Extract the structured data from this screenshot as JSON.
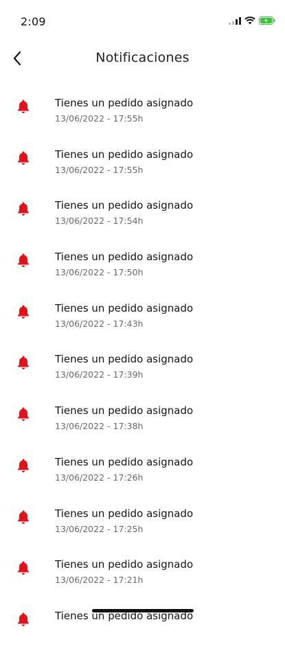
{
  "status_bar": {
    "time": "2:09"
  },
  "header": {
    "title": "Notificaciones"
  },
  "colors": {
    "bell": "#e0131a",
    "battery": "#3fc33f"
  },
  "icons": {
    "back": "chevron-left-icon",
    "notification": "bell-icon"
  },
  "notifications": [
    {
      "title": "Tienes un pedido asignado",
      "time": "13/06/2022 - 17:55h"
    },
    {
      "title": "Tienes un pedido asignado",
      "time": "13/06/2022 - 17:55h"
    },
    {
      "title": "Tienes un pedido asignado",
      "time": "13/06/2022 - 17:54h"
    },
    {
      "title": "Tienes un pedido asignado",
      "time": "13/06/2022 - 17:50h"
    },
    {
      "title": "Tienes un pedido asignado",
      "time": "13/06/2022 - 17:43h"
    },
    {
      "title": "Tienes un pedido asignado",
      "time": "13/06/2022 - 17:39h"
    },
    {
      "title": "Tienes un pedido asignado",
      "time": "13/06/2022 - 17:38h"
    },
    {
      "title": "Tienes un pedido asignado",
      "time": "13/06/2022 - 17:26h"
    },
    {
      "title": "Tienes un pedido asignado",
      "time": "13/06/2022 - 17:25h"
    },
    {
      "title": "Tienes un pedido asignado",
      "time": "13/06/2022 - 17:21h"
    },
    {
      "title": "Tienes un pedido asignado",
      "time": ""
    }
  ]
}
